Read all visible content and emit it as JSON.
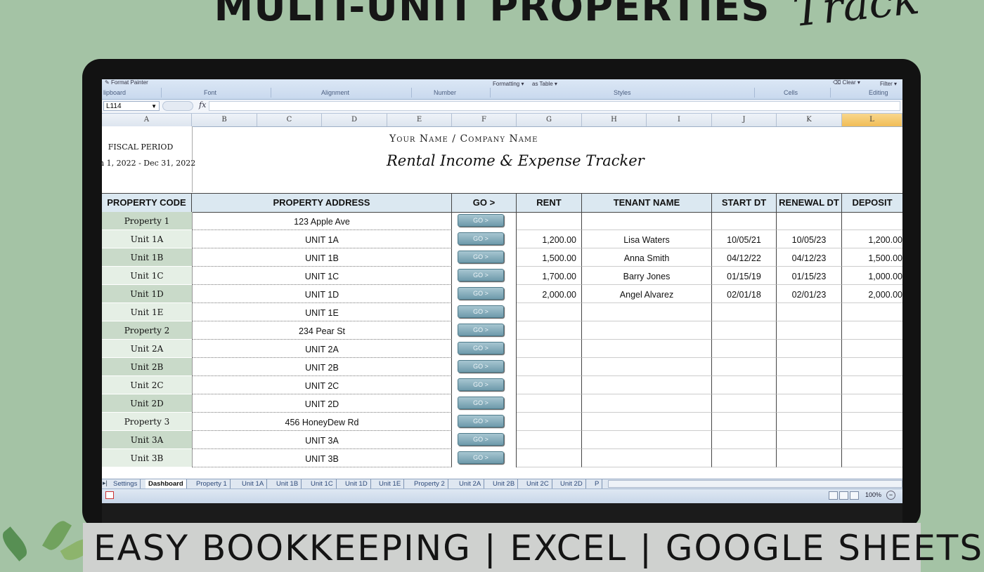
{
  "banner": {
    "headline": "MULTI-UNIT PROPERTIES",
    "corner_script": "Track",
    "bottom": "EASY BOOKKEEPING | EXCEL | GOOGLE SHEETS"
  },
  "ribbon": {
    "top_items": [
      "Format Painter",
      "Formatting",
      "as Table",
      "Clear",
      "Filter"
    ],
    "groups": [
      "lipboard",
      "Font",
      "Alignment",
      "Number",
      "Styles",
      "Cells",
      "Editing"
    ]
  },
  "formula_bar": {
    "name_box": "L114",
    "fx_label": "fx",
    "formula": ""
  },
  "columns": [
    "A",
    "B",
    "C",
    "D",
    "E",
    "F",
    "G",
    "H",
    "I",
    "J",
    "K",
    "L"
  ],
  "selected_column": "L",
  "sheet_header": {
    "fiscal_label": "FISCAL PERIOD",
    "fiscal_dates": "n 1, 2022 - Dec 31, 2022",
    "company": "Your Name / Company Name",
    "title": "Rental Income & Expense Tracker"
  },
  "table": {
    "headers": [
      "PROPERTY CODE",
      "PROPERTY ADDRESS",
      "GO >",
      "RENT",
      "TENANT NAME",
      "START DT",
      "RENEWAL DT",
      "DEPOSIT"
    ],
    "go_label": "GO >",
    "rows": [
      {
        "code": "Property 1",
        "address": "123 Apple Ave",
        "rent": "",
        "tenant": "",
        "start": "",
        "renewal": "",
        "deposit": "",
        "shade": "dark"
      },
      {
        "code": "Unit 1A",
        "address": "UNIT 1A",
        "rent": "1,200.00",
        "tenant": "Lisa Waters",
        "start": "10/05/21",
        "renewal": "10/05/23",
        "deposit": "1,200.00",
        "shade": "light"
      },
      {
        "code": "Unit 1B",
        "address": "UNIT 1B",
        "rent": "1,500.00",
        "tenant": "Anna Smith",
        "start": "04/12/22",
        "renewal": "04/12/23",
        "deposit": "1,500.00",
        "shade": "dark"
      },
      {
        "code": "Unit 1C",
        "address": "UNIT 1C",
        "rent": "1,700.00",
        "tenant": "Barry Jones",
        "start": "01/15/19",
        "renewal": "01/15/23",
        "deposit": "1,000.00",
        "shade": "light"
      },
      {
        "code": "Unit 1D",
        "address": "UNIT 1D",
        "rent": "2,000.00",
        "tenant": "Angel Alvarez",
        "start": "02/01/18",
        "renewal": "02/01/23",
        "deposit": "2,000.00",
        "shade": "dark"
      },
      {
        "code": "Unit 1E",
        "address": "UNIT 1E",
        "rent": "",
        "tenant": "",
        "start": "",
        "renewal": "",
        "deposit": "",
        "shade": "light"
      },
      {
        "code": "Property 2",
        "address": "234 Pear St",
        "rent": "",
        "tenant": "",
        "start": "",
        "renewal": "",
        "deposit": "",
        "shade": "dark"
      },
      {
        "code": "Unit 2A",
        "address": "UNIT 2A",
        "rent": "",
        "tenant": "",
        "start": "",
        "renewal": "",
        "deposit": "",
        "shade": "light"
      },
      {
        "code": "Unit 2B",
        "address": "UNIT 2B",
        "rent": "",
        "tenant": "",
        "start": "",
        "renewal": "",
        "deposit": "",
        "shade": "dark"
      },
      {
        "code": "Unit 2C",
        "address": "UNIT 2C",
        "rent": "",
        "tenant": "",
        "start": "",
        "renewal": "",
        "deposit": "",
        "shade": "light"
      },
      {
        "code": "Unit 2D",
        "address": "UNIT 2D",
        "rent": "",
        "tenant": "",
        "start": "",
        "renewal": "",
        "deposit": "",
        "shade": "dark"
      },
      {
        "code": "Property 3",
        "address": "456 HoneyDew Rd",
        "rent": "",
        "tenant": "",
        "start": "",
        "renewal": "",
        "deposit": "",
        "shade": "light"
      },
      {
        "code": "Unit 3A",
        "address": "UNIT 3A",
        "rent": "",
        "tenant": "",
        "start": "",
        "renewal": "",
        "deposit": "",
        "shade": "dark"
      },
      {
        "code": "Unit 3B",
        "address": "UNIT 3B",
        "rent": "",
        "tenant": "",
        "start": "",
        "renewal": "",
        "deposit": "",
        "shade": "light"
      }
    ]
  },
  "sheet_tabs": {
    "items": [
      "Settings",
      "Dashboard",
      "Property 1",
      "Unit 1A",
      "Unit 1B",
      "Unit 1C",
      "Unit 1D",
      "Unit 1E",
      "Property 2",
      "Unit 2A",
      "Unit 2B",
      "Unit 2C",
      "Unit 2D",
      "P"
    ],
    "active": "Dashboard"
  },
  "status_bar": {
    "zoom": "100%"
  }
}
